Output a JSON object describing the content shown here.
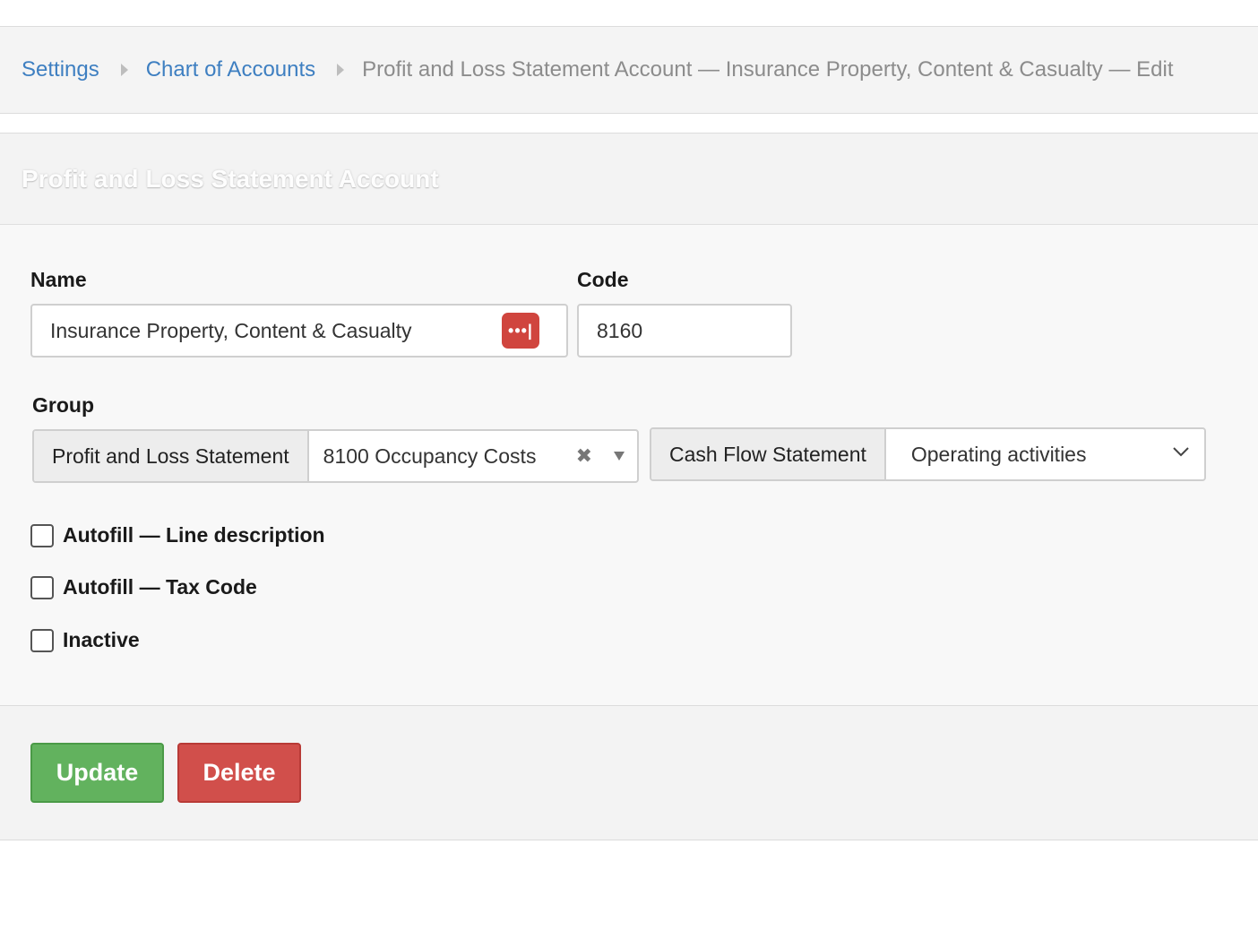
{
  "breadcrumb": {
    "items": [
      {
        "label": "Settings"
      },
      {
        "label": "Chart of Accounts"
      }
    ],
    "current": "Profit and Loss Statement Account — Insurance Property, Content & Casualty — Edit"
  },
  "panel": {
    "title": "Profit and Loss Statement Account"
  },
  "form": {
    "name_label": "Name",
    "name_value": "Insurance Property, Content & Casualty",
    "password_manager_icon": "•••|",
    "code_label": "Code",
    "code_value": "8160",
    "group_label": "Group",
    "group_addon": "Profit and Loss Statement",
    "group_value": "8100 Occupancy Costs",
    "clear_glyph": "✖",
    "cashflow_addon": "Cash Flow Statement",
    "cashflow_value": "Operating activities",
    "checkboxes": [
      {
        "label": "Autofill — Line description",
        "checked": false
      },
      {
        "label": "Autofill — Tax Code",
        "checked": false
      },
      {
        "label": "Inactive",
        "checked": false
      }
    ]
  },
  "actions": {
    "update_label": "Update",
    "delete_label": "Delete"
  },
  "colors": {
    "link": "#3e7fc1",
    "update_button": "#62b25e",
    "delete_button": "#d14f4b",
    "password_icon": "#d0453e"
  },
  "icons": {
    "breadcrumb_separator": "triangle-right-icon",
    "password_manager": "password-manager-icon",
    "clear": "clear-icon",
    "group_dropdown": "triangle-down-icon",
    "cashflow_dropdown": "chevron-down-icon"
  }
}
